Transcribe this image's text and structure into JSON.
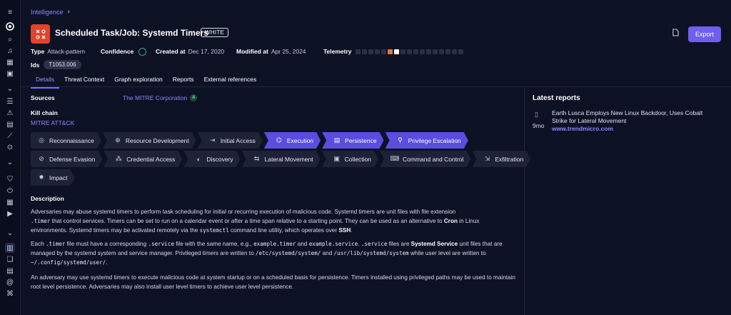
{
  "breadcrumb": {
    "root": "Intelligence"
  },
  "header": {
    "title": "Scheduled Task/Job: Systemd Timers",
    "tlp": "WHITE",
    "export_label": "Export"
  },
  "meta": {
    "type_label": "Type",
    "type_value": "Attack-pattern",
    "confidence_label": "Confidence",
    "created_label": "Created at",
    "created_value": "Dec 17, 2020",
    "modified_label": "Modified at",
    "modified_value": "Apr 25, 2024",
    "telemetry_label": "Telemetry",
    "telemetry_cells": [
      "#2a3046",
      "#2a3046",
      "#2a3046",
      "#2a3046",
      "#2a3046",
      "#e07a3a",
      "#ffffff",
      "#2a3046",
      "#2a3046",
      "#2a3046",
      "#2a3046",
      "#2a3046",
      "#2a3046",
      "#2a3046",
      "#2a3046",
      "#2a3046",
      "#2a3046"
    ],
    "ids_label": "Ids",
    "id_value": "T1053.006"
  },
  "tabs": [
    "Details",
    "Threat Context",
    "Graph exploration",
    "Reports",
    "External references"
  ],
  "sources": {
    "label": "Sources",
    "value": "The MITRE Corporation",
    "badge": "A"
  },
  "kill_chain": {
    "label": "Kill chain",
    "framework": "MITRE ATT&CK",
    "row1": [
      {
        "label": "Reconnaissance",
        "icon": "◎",
        "hl": false
      },
      {
        "label": "Resource Development",
        "icon": "⊕",
        "hl": false
      },
      {
        "label": "Initial Access",
        "icon": "⇥",
        "hl": false
      },
      {
        "label": "Execution",
        "icon": "⌬",
        "hl": true
      },
      {
        "label": "Persistence",
        "icon": "▤",
        "hl": true
      },
      {
        "label": "Privilege Escalation",
        "icon": "⚲",
        "hl": true
      }
    ],
    "row2": [
      {
        "label": "Defense Evasion",
        "icon": "⊘",
        "hl": false
      },
      {
        "label": "Credential Access",
        "icon": "⁂",
        "hl": false
      },
      {
        "label": "Discovery",
        "icon": "◐",
        "hl": false
      },
      {
        "label": "Lateral Movement",
        "icon": "⇆",
        "hl": false
      },
      {
        "label": "Collection",
        "icon": "▣",
        "hl": false
      },
      {
        "label": "Command and Control",
        "icon": "⌨",
        "hl": false
      },
      {
        "label": "Exfiltration",
        "icon": "⇲",
        "hl": false
      }
    ],
    "row3": [
      {
        "label": "Impact",
        "icon": "✸",
        "hl": false
      }
    ]
  },
  "description": {
    "label": "Description",
    "p1_a": "Adversaries may abuse systemd timers to perform task scheduling for initial or recurring execution of malicious code. Systemd timers are unit files with file extension",
    "p1_code1": ".timer",
    "p1_b": " that control services. Timers can be set to run on a calendar event or after a time span relative to a starting point. They can be used as an alternative to ",
    "p1_bold1": "Cron",
    "p1_c": " in Linux environments. Systemd timers may be activated remotely via the ",
    "p1_code2": "systemctl",
    "p1_d": " command line utility, which operates over ",
    "p1_bold2": "SSH",
    "p1_e": ".",
    "p2_a": "Each ",
    "p2_code1": ".timer",
    "p2_b": " file must have a corresponding ",
    "p2_code2": ".service",
    "p2_c": " file with the same name, e.g., ",
    "p2_code3": "example.timer",
    "p2_d": " and ",
    "p2_code4": "example.service",
    "p2_e": ". ",
    "p2_code5": ".service",
    "p2_f": " files are ",
    "p2_bold1": "Systemd Service",
    "p2_g": " unit files that are managed by the systemd system and service manager. Privileged timers are written to ",
    "p2_code6": "/etc/systemd/system/",
    "p2_h": " and ",
    "p2_code7": "/usr/lib/systemd/system",
    "p2_i": " while user level are written to ",
    "p2_code8": "~/.config/systemd/user/",
    "p2_j": ".",
    "p3": "An adversary may use systemd timers to execute malicious code at system startup or on a scheduled basis for persistence. Timers installed using privileged paths may be used to maintain root level persistence. Adversaries may also install user level timers to achieve user level persistence."
  },
  "latest_reports": {
    "title": "Latest reports",
    "items": [
      {
        "age": "9mo",
        "title": "Earth Lusca Employs New Linux Backdoor, Uses Cobalt Strike for Lateral Movement",
        "source": "www.trendmicro.com"
      }
    ]
  }
}
